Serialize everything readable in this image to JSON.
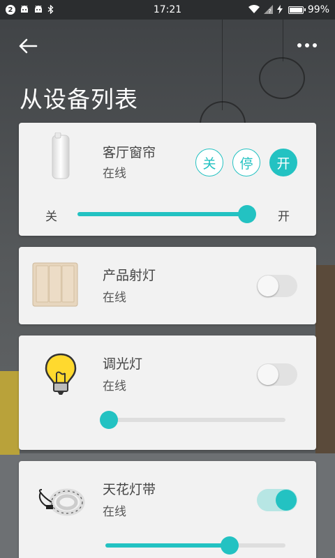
{
  "status_bar": {
    "notification_count": "2",
    "time": "17:21",
    "battery_text": "99%",
    "battery_level": 0.99
  },
  "header": {
    "title": "从设备列表"
  },
  "accent_color": "#23c2c2",
  "devices": [
    {
      "name": "客厅窗帘",
      "status": "在线",
      "icon": "curtain-motor-icon",
      "buttons": [
        "关",
        "停",
        "开"
      ],
      "active_button": "开",
      "slider": {
        "min_label": "关",
        "max_label": "开",
        "value": 0.95
      }
    },
    {
      "name": "产品射灯",
      "status": "在线",
      "icon": "wall-switch-icon",
      "toggle_on": false
    },
    {
      "name": "调光灯",
      "status": "在线",
      "icon": "light-bulb-icon",
      "toggle_on": false,
      "slider": {
        "value": 0.02
      }
    },
    {
      "name": "天花灯带",
      "status": "在线",
      "icon": "led-strip-icon",
      "toggle_on": true,
      "slider": {
        "value": 0.69
      }
    }
  ]
}
